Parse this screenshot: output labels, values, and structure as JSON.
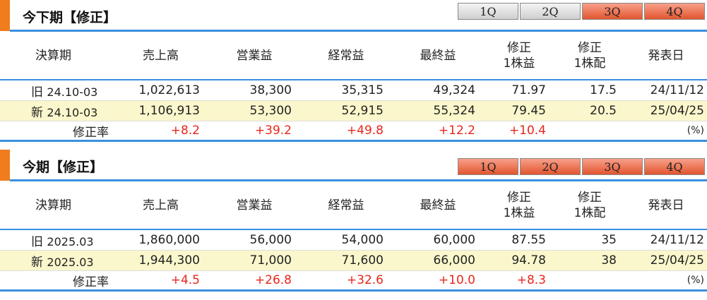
{
  "sections": [
    {
      "title": "今下期【修正】",
      "tabs": [
        {
          "label": "1Q",
          "style": "gray"
        },
        {
          "label": "2Q",
          "style": "gray"
        },
        {
          "label": "3Q",
          "style": "red"
        },
        {
          "label": "4Q",
          "style": "red"
        }
      ],
      "headers": [
        "決算期",
        "売上高",
        "営業益",
        "経常益",
        "最終益",
        "修正\n1株益",
        "修正\n1株配",
        "発表日"
      ],
      "rows": [
        {
          "prefix": "旧",
          "period": "24.10-03",
          "values": [
            "1,022,613",
            "38,300",
            "35,315",
            "49,324",
            "71.97",
            "17.5",
            "24/11/12"
          ]
        },
        {
          "prefix": "新",
          "period": "24.10-03",
          "values": [
            "1,106,913",
            "53,300",
            "52,915",
            "55,324",
            "79.45",
            "20.5",
            "25/04/25"
          ]
        }
      ],
      "rate": {
        "label": "修正率",
        "values": [
          "+8.2",
          "+39.2",
          "+49.8",
          "+12.2",
          "+10.4"
        ],
        "unit": "(%)"
      }
    },
    {
      "title": "今期【修正】",
      "tabs": [
        {
          "label": "1Q",
          "style": "red"
        },
        {
          "label": "2Q",
          "style": "red"
        },
        {
          "label": "3Q",
          "style": "red"
        },
        {
          "label": "4Q",
          "style": "red"
        }
      ],
      "headers": [
        "決算期",
        "売上高",
        "営業益",
        "経常益",
        "最終益",
        "修正\n1株益",
        "修正\n1株配",
        "発表日"
      ],
      "rows": [
        {
          "prefix": "旧",
          "period": "2025.03",
          "values": [
            "1,860,000",
            "56,000",
            "54,000",
            "60,000",
            "87.55",
            "35",
            "24/11/12"
          ]
        },
        {
          "prefix": "新",
          "period": "2025.03",
          "values": [
            "1,944,300",
            "71,000",
            "71,600",
            "66,000",
            "94.78",
            "38",
            "25/04/25"
          ]
        }
      ],
      "rate": {
        "label": "修正率",
        "values": [
          "+4.5",
          "+26.8",
          "+32.6",
          "+10.0",
          "+8.3"
        ],
        "unit": "(%)"
      }
    }
  ]
}
